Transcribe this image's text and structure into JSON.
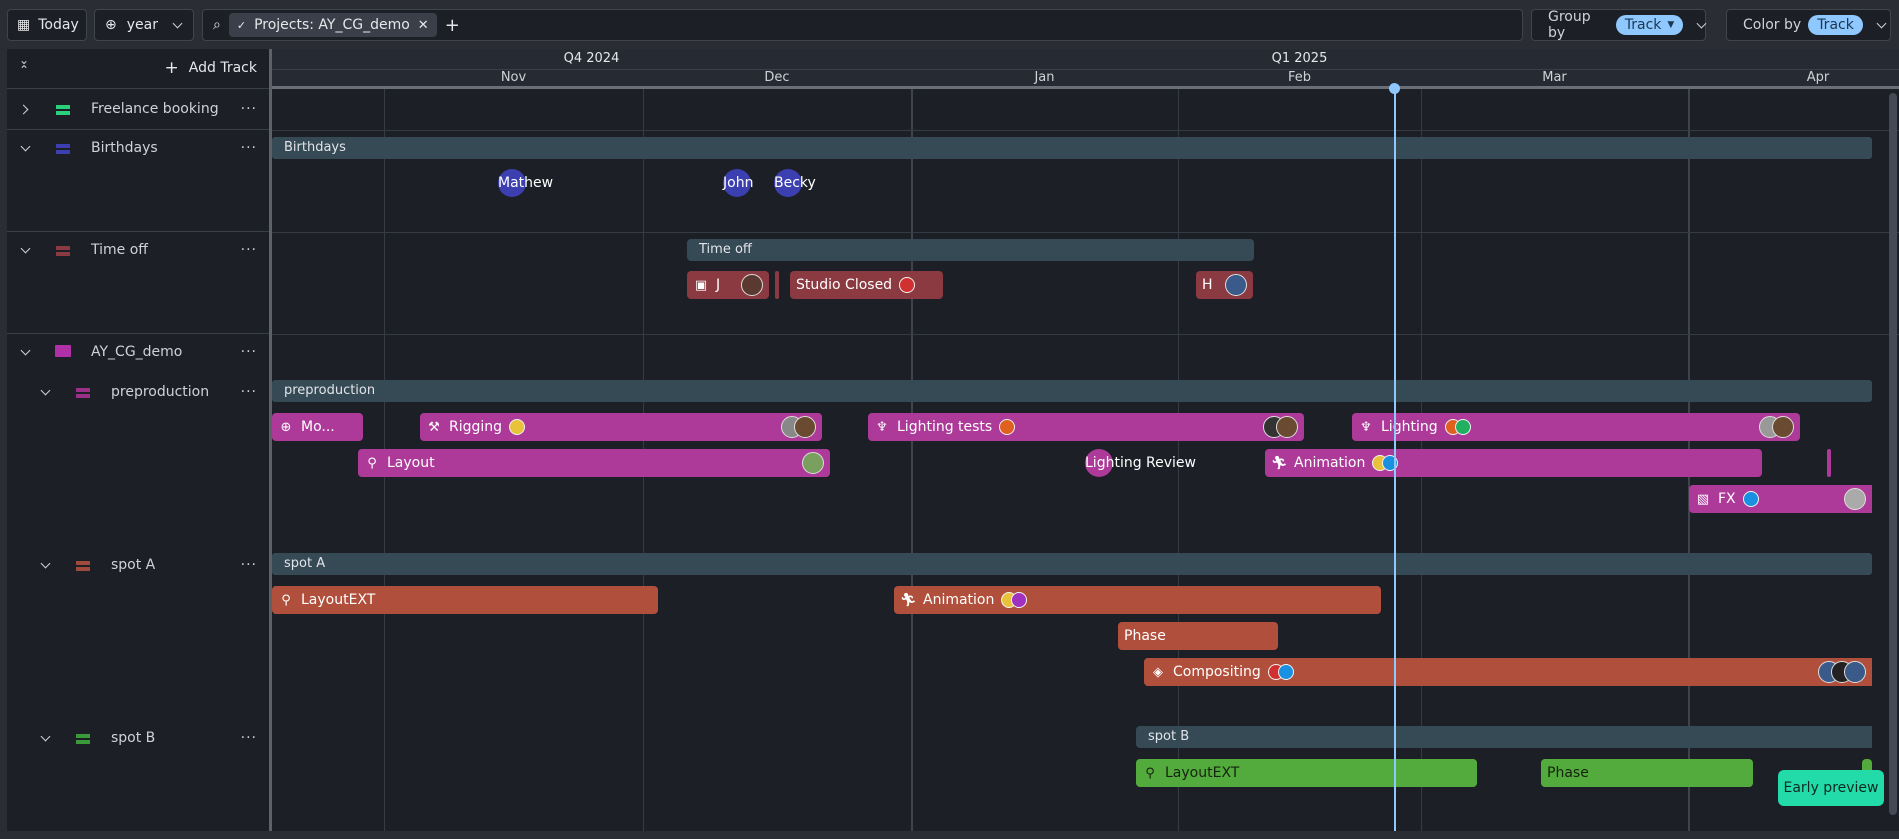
{
  "toolbar": {
    "today_label": "Today",
    "zoom_level": "year",
    "filter_chip": "Projects: AY_CG_demo",
    "group_by_label": "Group by",
    "group_by_value": "Track",
    "color_by_label": "Color by",
    "color_by_value": "Track"
  },
  "sidebar": {
    "add_track_label": "Add Track",
    "tracks": [
      {
        "name": "Freelance booking",
        "color": "#2bd07a",
        "expanded": false
      },
      {
        "name": "Birthdays",
        "color": "#3b3fb0",
        "expanded": true
      },
      {
        "name": "Time off",
        "color": "#8a3a40",
        "expanded": true
      },
      {
        "name": "AY_CG_demo",
        "color": "#b030a8",
        "expanded": true,
        "type": "folder"
      },
      {
        "name": "preproduction",
        "color": "#9a3088",
        "expanded": true
      },
      {
        "name": "spot A",
        "color": "#a04a3c",
        "expanded": true
      },
      {
        "name": "spot B",
        "color": "#3a9a3a",
        "expanded": true
      }
    ]
  },
  "timeline": {
    "quarters": [
      "Q4 2024",
      "Q1 2025"
    ],
    "months": [
      "Nov",
      "Dec",
      "Jan",
      "Feb",
      "Mar",
      "Apr"
    ],
    "groups": [
      "Birthdays",
      "Time off",
      "preproduction",
      "spot A",
      "spot B"
    ],
    "birthdays": [
      "Mathew",
      "John",
      "Becky"
    ],
    "time_off": {
      "item1": "J",
      "item2": "Studio Closed",
      "item3": "H"
    },
    "preproduction": {
      "modeling": "Mo...",
      "rigging": "Rigging",
      "lighting_tests": "Lighting tests",
      "lighting": "Lighting",
      "layout": "Layout",
      "lighting_review": "Lighting Review",
      "animation": "Animation",
      "fx": "FX"
    },
    "spot_a": {
      "layout": "LayoutEXT",
      "animation": "Animation",
      "phase": "Phase",
      "compositing": "Compositing"
    },
    "spot_b": {
      "layout": "LayoutEXT",
      "phase": "Phase"
    }
  },
  "colors": {
    "today_marker": "#8ec8ff",
    "preproduction": "#ad3a99",
    "spot_a": "#b04f3c",
    "spot_b": "#52ab3c",
    "time_off": "#8a3a40",
    "birthday": "#3b3fb0"
  },
  "early_preview_label": "Early preview"
}
